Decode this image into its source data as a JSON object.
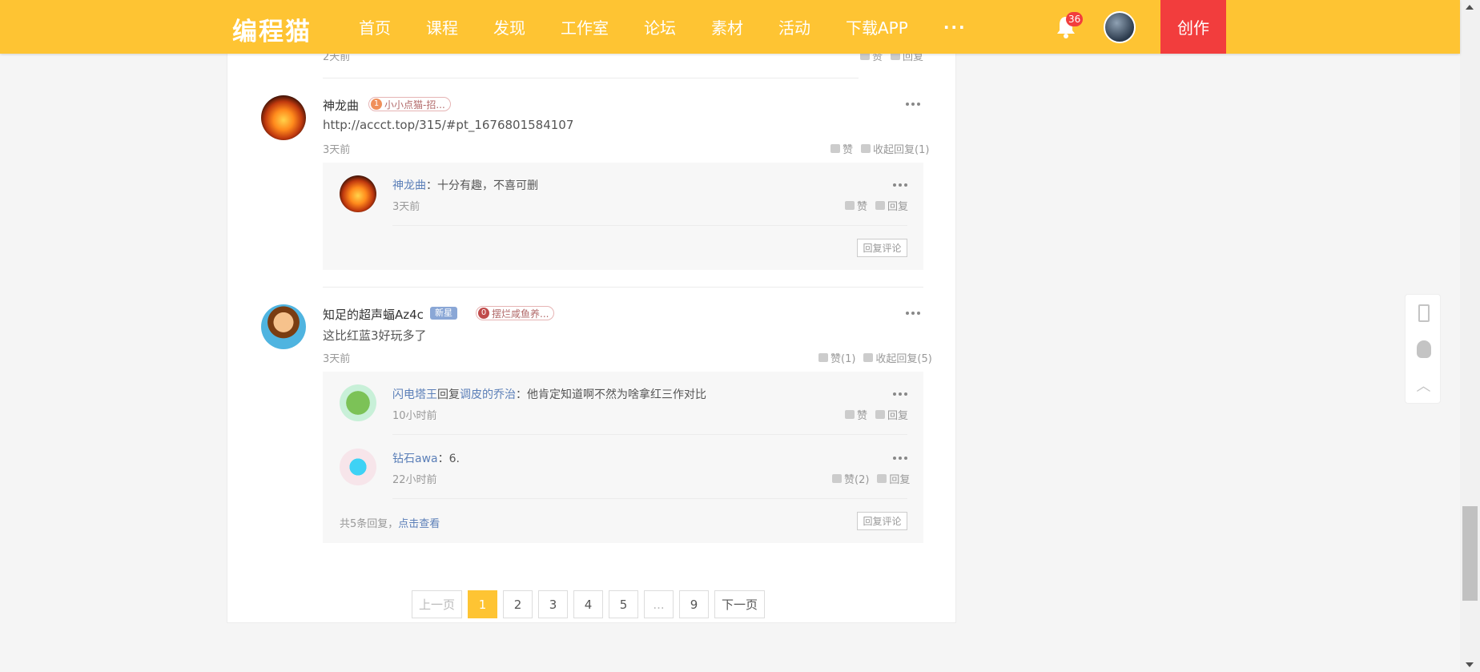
{
  "nav": {
    "logo": "编程猫",
    "items": [
      "首页",
      "课程",
      "发现",
      "工作室",
      "论坛",
      "素材",
      "活动",
      "下载APP"
    ],
    "more": "···",
    "bell_count": "36",
    "create": "创作"
  },
  "prev_comment": {
    "time": "2天前",
    "like": "赞",
    "reply": "回复"
  },
  "comments": [
    {
      "user": "神龙曲",
      "badge_num": "1",
      "badge": "小小点猫-招...",
      "text": "http://accct.top/315/#pt_1676801584107",
      "time": "3天前",
      "like": "赞",
      "collapse": "收起回复(1)",
      "replies": [
        {
          "user": "神龙曲",
          "sep": "：",
          "text": "十分有趣，不喜可删",
          "time": "3天前",
          "like": "赞",
          "reply": "回复"
        }
      ],
      "reply_comment": "回复评论"
    },
    {
      "user": "知足的超声蝠Az4c",
      "newstar": "新星",
      "badge_num": "0",
      "badge": "摆烂咸鱼养...",
      "text": "这比红蓝3好玩多了",
      "time": "3天前",
      "like": "赞(1)",
      "collapse": "收起回复(5)",
      "replies": [
        {
          "user": "闪电塔王",
          "mid": "回复",
          "target": "调皮的乔治",
          "sep": "：",
          "text": "他肯定知道啊不然为啥拿红三作对比",
          "time": "10小时前",
          "like": "赞",
          "reply": "回复"
        },
        {
          "user": "钻石awa",
          "sep": "：",
          "text": "6.",
          "time": "22小时前",
          "like": "赞(2)",
          "reply": "回复"
        }
      ],
      "total_prefix": "共5条回复，",
      "total_link": "点击查看",
      "reply_comment": "回复评论"
    }
  ],
  "pager": {
    "prev": "上一页",
    "pages": [
      "1",
      "2",
      "3",
      "4",
      "5",
      "...",
      "9"
    ],
    "next": "下一页"
  },
  "colors": {
    "brand": "#fec433",
    "create": "#f23d3d",
    "link": "#5b7fb8"
  },
  "side_icons": [
    "phone-icon",
    "qq-icon",
    "back-to-top-icon"
  ]
}
